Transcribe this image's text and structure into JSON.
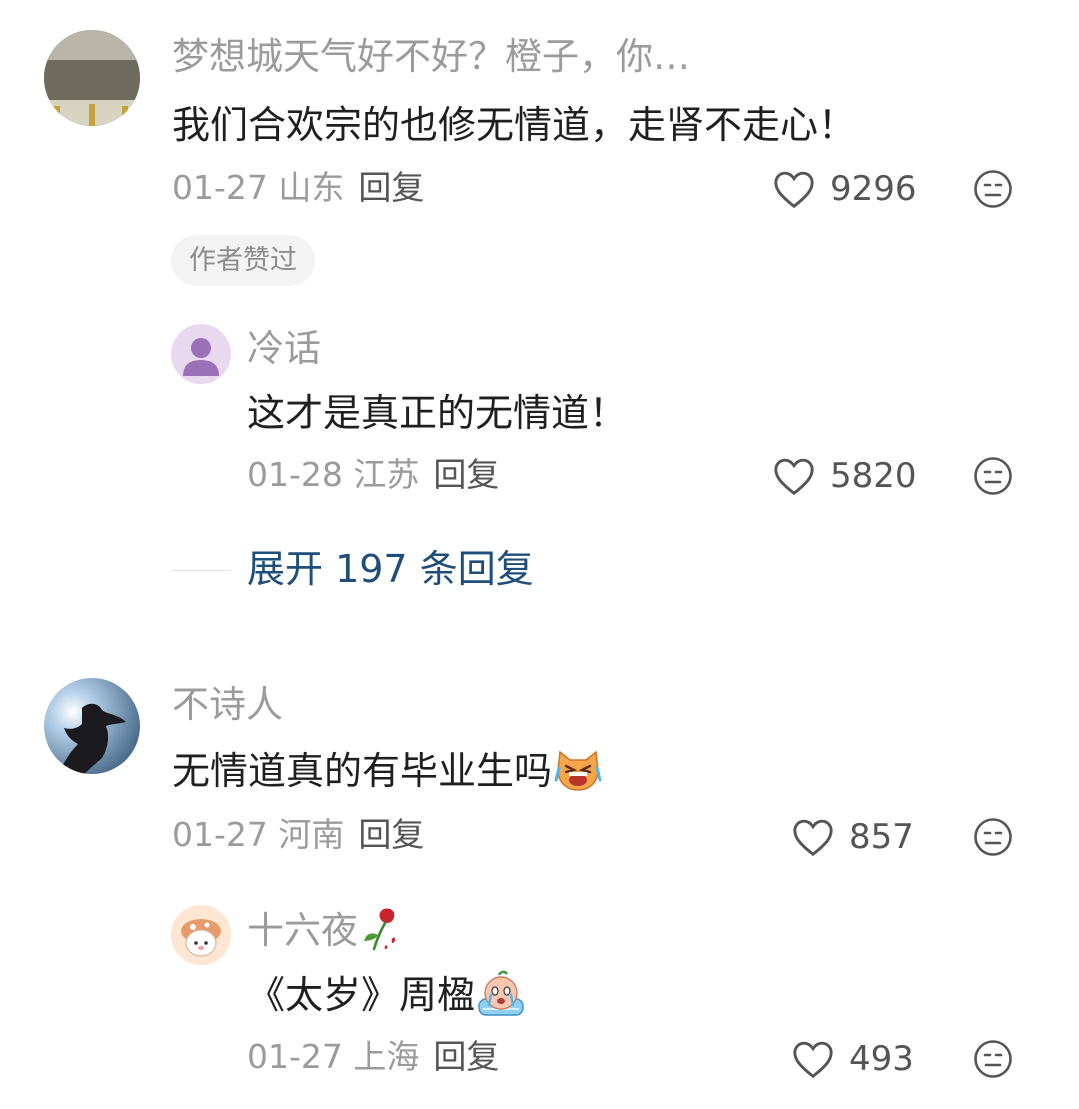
{
  "comments": [
    {
      "name": "梦想城天气好不好？橙子，你…",
      "content": "我们合欢宗的也修无情道，走肾不走心！",
      "date_loc": "01-27 山东",
      "reply_label": "回复",
      "likes": "9296",
      "badge": "作者赞过"
    },
    {
      "name": "冷话",
      "content": "这才是真正的无情道！",
      "date_loc": "01-28 江苏",
      "reply_label": "回复",
      "likes": "5820"
    },
    {
      "name": "不诗人",
      "content": "无情道真的有毕业生吗",
      "date_loc": "01-27 河南",
      "reply_label": "回复",
      "likes": "857"
    },
    {
      "name": "十六夜",
      "content": "《太岁》周楹",
      "date_loc": "01-27 上海",
      "reply_label": "回复",
      "likes": "493"
    }
  ],
  "expand_replies": "展开 197 条回复",
  "colors": {
    "name": "#9b9b9b",
    "content": "#1f1f1f",
    "link": "#1f4e7a",
    "badge_bg": "#f3f3f3"
  },
  "icons": [
    "heart-outline-icon",
    "meh-face-icon",
    "rose-emoji",
    "crying-cat-emoji",
    "crying-face-emoji"
  ]
}
